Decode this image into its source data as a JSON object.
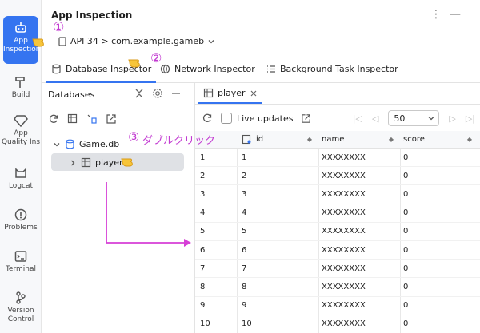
{
  "sidebar": {
    "items": [
      {
        "label": "App Inspection",
        "icon": "robot-icon",
        "active": true
      },
      {
        "label": "Build",
        "icon": "hammer-icon"
      },
      {
        "label": "App Quality Ins",
        "icon": "diamond-icon"
      },
      {
        "label": "Logcat",
        "icon": "cat-icon"
      },
      {
        "label": "Problems",
        "icon": "warning-icon"
      },
      {
        "label": "Terminal",
        "icon": "terminal-icon"
      },
      {
        "label": "Version Control",
        "icon": "branch-icon"
      }
    ]
  },
  "header": {
    "title": "App Inspection",
    "more_glyph": "⋮",
    "minimize_glyph": "—",
    "process": "API 34 > com.example.gameb"
  },
  "tabs": [
    {
      "label": "Database Inspector",
      "icon": "database-icon",
      "active": true
    },
    {
      "label": "Network Inspector",
      "icon": "globe-icon",
      "active": false
    },
    {
      "label": "Background Task Inspector",
      "icon": "list-icon",
      "active": false
    }
  ],
  "databases": {
    "title": "Databases",
    "tree": {
      "db": "Game.db",
      "table": "player"
    }
  },
  "table_view": {
    "tab_label": "player",
    "live_updates_label": "Live updates",
    "page_size": "50",
    "columns": [
      "id",
      "name",
      "score"
    ],
    "rows": [
      [
        "1",
        "1",
        "XXXXXXXX",
        "0"
      ],
      [
        "2",
        "2",
        "XXXXXXXX",
        "0"
      ],
      [
        "3",
        "3",
        "XXXXXXXX",
        "0"
      ],
      [
        "4",
        "4",
        "XXXXXXXX",
        "0"
      ],
      [
        "5",
        "5",
        "XXXXXXXX",
        "0"
      ],
      [
        "6",
        "6",
        "XXXXXXXX",
        "0"
      ],
      [
        "7",
        "7",
        "XXXXXXXX",
        "0"
      ],
      [
        "8",
        "8",
        "XXXXXXXX",
        "0"
      ],
      [
        "9",
        "9",
        "XXXXXXXX",
        "0"
      ],
      [
        "10",
        "10",
        "XXXXXXXX",
        "0"
      ]
    ]
  },
  "annotations": {
    "step1": "①",
    "step2": "②",
    "step3": "③",
    "step3_text": "ダブルクリック",
    "color": "#c23ad1"
  },
  "colors": {
    "accent": "#3574f0",
    "annotation": "#c23ad1"
  }
}
